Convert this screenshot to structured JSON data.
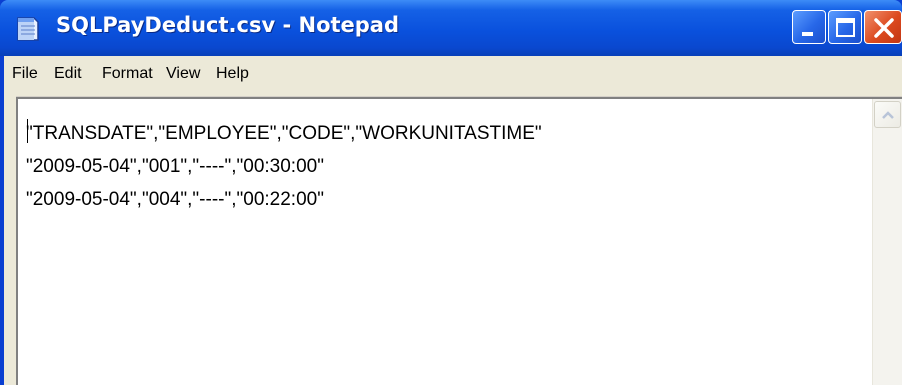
{
  "window": {
    "title": "SQLPayDeduct.csv - Notepad",
    "icon": "notepad-icon"
  },
  "titlebar_controls": {
    "minimize_icon": "minimize-icon",
    "maximize_icon": "maximize-icon",
    "close_icon": "close-icon"
  },
  "menu": {
    "items": [
      "File",
      "Edit",
      "Format",
      "View",
      "Help"
    ]
  },
  "document": {
    "lines": [
      "\"TRANSDATE\",\"EMPLOYEE\",\"CODE\",\"WORKUNITASTIME\"",
      "\"2009-05-04\",\"001\",\"----\",\"00:30:00\"",
      "\"2009-05-04\",\"004\",\"----\",\"00:22:00\""
    ]
  },
  "scrollbar": {
    "up_icon": "scroll-up-arrow-icon"
  },
  "colors": {
    "titlebar": "#0a51dd",
    "menubar": "#ece9d8",
    "close_button": "#dc4a1f"
  }
}
